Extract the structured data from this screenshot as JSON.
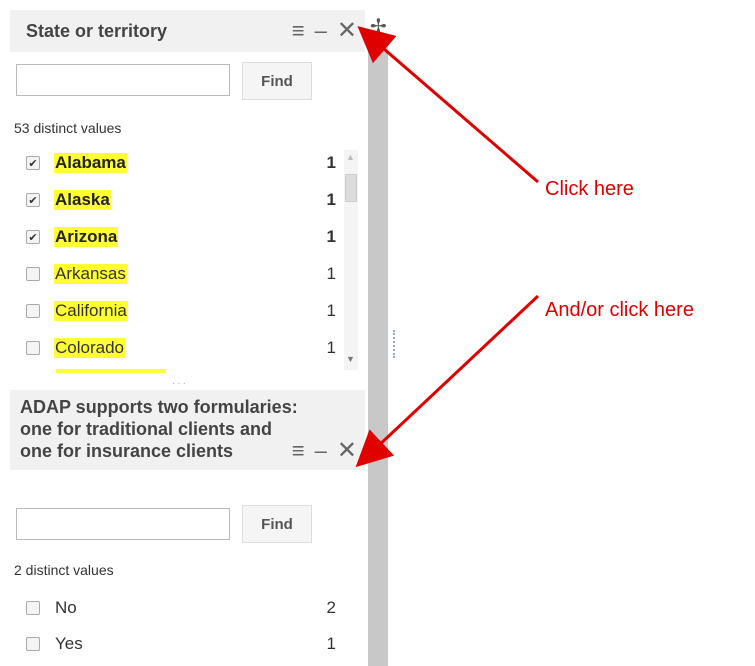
{
  "panel1": {
    "title": "State or territory",
    "find_label": "Find",
    "find_value": "",
    "distinct": "53 distinct values",
    "items": [
      {
        "label": "Alabama",
        "count": "1",
        "checked": true
      },
      {
        "label": "Alaska",
        "count": "1",
        "checked": true
      },
      {
        "label": "Arizona",
        "count": "1",
        "checked": true
      },
      {
        "label": "Arkansas",
        "count": "1",
        "checked": false
      },
      {
        "label": "California",
        "count": "1",
        "checked": false
      },
      {
        "label": "Colorado",
        "count": "1",
        "checked": false
      }
    ]
  },
  "panel2": {
    "title_lines": [
      "ADAP supports two formularies:",
      "one for traditional clients and",
      "one for insurance clients"
    ],
    "find_label": "Find",
    "find_value": "",
    "distinct": "2 distinct values",
    "items": [
      {
        "label": "No",
        "count": "2",
        "checked": false
      },
      {
        "label": "Yes",
        "count": "1",
        "checked": false
      }
    ]
  },
  "annotations": {
    "click_here": "Click here",
    "and_or_click_here": "And/or click here",
    "color": "#e00000"
  },
  "icons": {
    "menu": "menu-icon",
    "minimize": "minimize-icon",
    "close": "close-icon"
  }
}
